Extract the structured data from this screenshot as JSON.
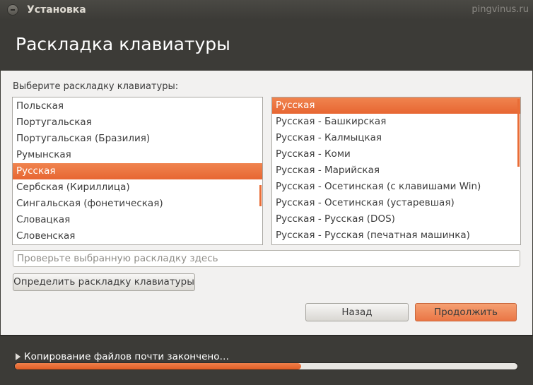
{
  "window": {
    "title": "Установка",
    "watermark": "pingvinus.ru"
  },
  "header": {
    "title": "Раскладка клавиатуры"
  },
  "main": {
    "prompt": "Выберите раскладку клавиатуры:",
    "layouts": [
      {
        "label": "Польская",
        "selected": false
      },
      {
        "label": "Португальская",
        "selected": false
      },
      {
        "label": "Португальская (Бразилия)",
        "selected": false
      },
      {
        "label": "Румынская",
        "selected": false
      },
      {
        "label": "Русская",
        "selected": true
      },
      {
        "label": "Сербская (Кириллица)",
        "selected": false
      },
      {
        "label": "Сингальская (фонетическая)",
        "selected": false
      },
      {
        "label": "Словацкая",
        "selected": false
      },
      {
        "label": "Словенская",
        "selected": false
      }
    ],
    "variants": [
      {
        "label": "Русская",
        "selected": true
      },
      {
        "label": "Русская - Башкирская",
        "selected": false
      },
      {
        "label": "Русская - Калмыцкая",
        "selected": false
      },
      {
        "label": "Русская - Коми",
        "selected": false
      },
      {
        "label": "Русская - Марийская",
        "selected": false
      },
      {
        "label": "Русская - Осетинская (с клавишами Win)",
        "selected": false
      },
      {
        "label": "Русская - Осетинская (устаревшая)",
        "selected": false
      },
      {
        "label": "Русская - Русская (DOS)",
        "selected": false
      },
      {
        "label": "Русская - Русская (печатная машинка)",
        "selected": false
      }
    ],
    "test_field": {
      "value": "",
      "placeholder": "Проверьте выбранную раскладку здесь"
    },
    "detect_button": "Определить раскладку клавиатуры",
    "back_button": "Назад",
    "continue_button": "Продолжить"
  },
  "footer": {
    "status": "Копирование файлов почти закончено…",
    "progress_percent": 57
  },
  "colors": {
    "accent": "#e76632",
    "header_bg": "#3c3b37",
    "content_bg": "#f2f1f0"
  },
  "icons": {
    "close": "close-icon",
    "expander": "expander-arrow-icon"
  }
}
